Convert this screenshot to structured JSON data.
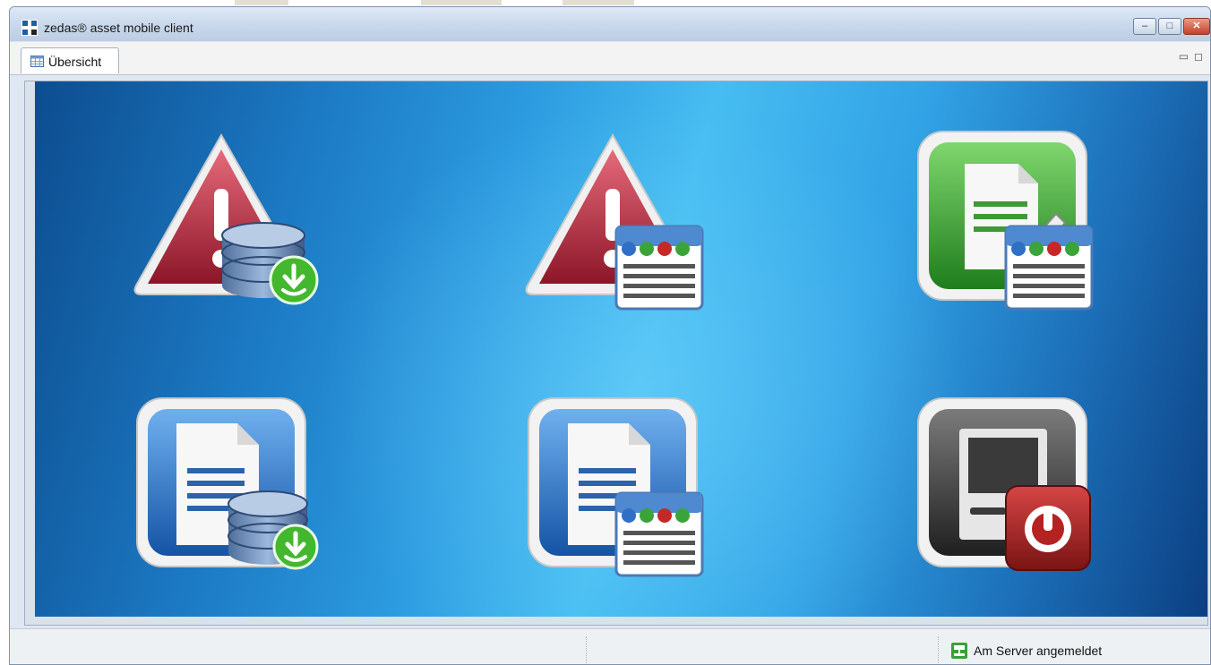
{
  "window": {
    "title": "zedas® asset mobile client",
    "buttons": {
      "minimize": "–",
      "maximize": "□",
      "close": "✕"
    }
  },
  "tabs": [
    {
      "label": "Übersicht",
      "icon": "table-icon",
      "active": true
    }
  ],
  "view_controls": {
    "minimize": "▭",
    "maximize": "◻"
  },
  "tiles": [
    {
      "name": "tile-warning-download",
      "icon": "warning-database-download-icon"
    },
    {
      "name": "tile-warning-list",
      "icon": "warning-table-edit-icon"
    },
    {
      "name": "tile-edit-list",
      "icon": "document-edit-table-icon"
    },
    {
      "name": "tile-document-download",
      "icon": "document-database-download-icon"
    },
    {
      "name": "tile-document-list",
      "icon": "document-table-edit-icon"
    },
    {
      "name": "tile-logout",
      "icon": "monitor-power-icon"
    }
  ],
  "statusbar": {
    "text": "Am Server angemeldet",
    "icon": "server-connected-icon"
  },
  "colors": {
    "accent_blue": "#1c7ac4",
    "warning_red": "#b0283a",
    "green": "#2f9a2c",
    "dark": "#2b2b2b",
    "power_red": "#9b1c1c"
  }
}
